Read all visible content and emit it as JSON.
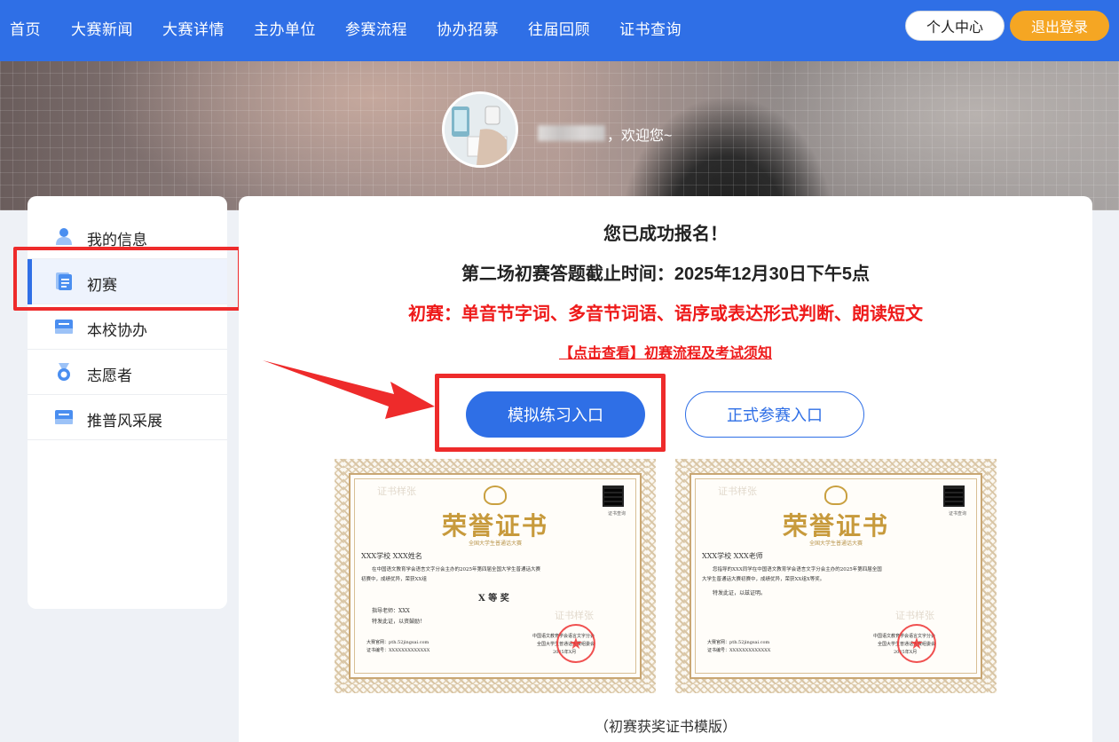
{
  "nav": {
    "items": [
      "首页",
      "大赛新闻",
      "大赛详情",
      "主办单位",
      "参赛流程",
      "协办招募",
      "往届回顾",
      "证书查询"
    ],
    "profile_label": "个人中心",
    "logout_label": "退出登录"
  },
  "banner": {
    "welcome": "，欢迎您~"
  },
  "sidebar": {
    "items": [
      {
        "label": "我的信息",
        "icon": "user-icon"
      },
      {
        "label": "初赛",
        "icon": "document-icon"
      },
      {
        "label": "本校协办",
        "icon": "school-card-icon"
      },
      {
        "label": "志愿者",
        "icon": "medal-icon"
      },
      {
        "label": "推普风采展",
        "icon": "showcase-card-icon"
      }
    ],
    "active_index": 1
  },
  "main": {
    "success_title": "您已成功报名！",
    "deadline": "第二场初赛答题截止时间：2025年12月30日下午5点",
    "content": "初赛：单音节字词、多音节词语、语序或表达形式判断、朗读短文",
    "notice_link": "【点击查看】初赛流程及考试须知",
    "mock_button": "模拟练习入口",
    "formal_button": "正式参赛入口",
    "caption": "（初赛获奖证书模版）"
  },
  "certificates": [
    {
      "title": "荣誉证书",
      "subtitle": "全国大学生普通话大赛",
      "qr_label": "证书查询",
      "name_line": "XXX学校  XXX姓名",
      "body1": "在中国语文教育学会语言文字分会主办的2025年第四届全国大学生普通话大赛",
      "body2": "初赛中，成绩优异，荣获XX组",
      "award": "X 等 奖",
      "teacher": "指导老师：XXX",
      "closing": "特发此证，以资鼓励！",
      "website": "大赛官网：pth.52jingsai.com",
      "cert_no": "证书编号：XXXXXXXXXXXXX",
      "org1": "中国语文教育学会语言文字分会",
      "org2": "全国大学生普通话大赛组委会",
      "date": "2025年X月",
      "watermark": "证书样张"
    },
    {
      "title": "荣誉证书",
      "subtitle": "全国大学生普通话大赛",
      "qr_label": "证书查询",
      "name_line": "XXX学校  XXX老师",
      "body1": "您指导的XXX同学在中国语文教育学会语言文字分会主办的2025年第四届全国",
      "body2": "大学生普通话大赛初赛中，成绩优异，荣获XX组X等奖。",
      "award": "",
      "teacher": "特发此证，以兹证明。",
      "closing": "",
      "website": "大赛官网：pth.52jingsai.com",
      "cert_no": "证书编号：XXXXXXXXXXXXX",
      "org1": "中国语文教育学会语言文字分会",
      "org2": "全国大学生普通话大赛组委会",
      "date": "2025年X月",
      "watermark": "证书样张"
    }
  ],
  "colors": {
    "primary": "#2f6fe6",
    "accent": "#f5a623",
    "alert": "#ee1a1a",
    "gold": "#c79a3c"
  }
}
